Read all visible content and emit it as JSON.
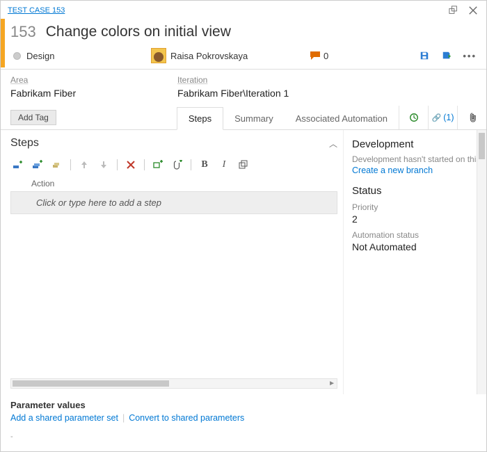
{
  "breadcrumb": "TEST CASE 153",
  "work_item": {
    "id": "153",
    "title": "Change colors on initial view",
    "state": "Design",
    "assignee": "Raisa Pokrovskaya",
    "discussion_count": "0"
  },
  "fields": {
    "area_label": "Area",
    "area_value": "Fabrikam Fiber",
    "iteration_label": "Iteration",
    "iteration_value": "Fabrikam Fiber\\Iteration 1"
  },
  "tags": {
    "add_label": "Add Tag"
  },
  "tabs": {
    "steps": "Steps",
    "summary": "Summary",
    "automation": "Associated Automation",
    "links_count": "(1)"
  },
  "steps": {
    "heading": "Steps",
    "action_col": "Action",
    "placeholder": "Click or type here to add a step"
  },
  "development": {
    "heading": "Development",
    "hint": "Development hasn't started on this",
    "create_branch": "Create a new branch"
  },
  "status": {
    "heading": "Status",
    "priority_label": "Priority",
    "priority_value": "2",
    "automation_label": "Automation status",
    "automation_value": "Not Automated"
  },
  "params": {
    "heading": "Parameter values",
    "add_shared": "Add a shared parameter set",
    "convert": "Convert to shared parameters"
  },
  "icons": {
    "link_glyph": "🔗",
    "ellipsis_glyph": "•••"
  }
}
